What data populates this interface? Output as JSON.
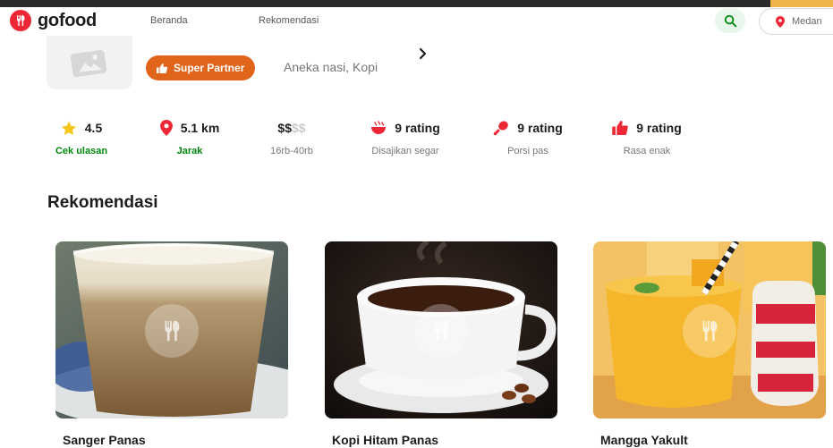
{
  "brand": {
    "name": "gofood",
    "color": "#ee2737"
  },
  "nav": {
    "links": [
      "Beranda",
      "Rekomendasi"
    ],
    "location": "Medan"
  },
  "restaurant": {
    "badge": "Super Partner",
    "badge_color": "#e0641a",
    "cuisine": "Aneka nasi, Kopi"
  },
  "stats": [
    {
      "icon": "star-icon",
      "value": "4.5",
      "label": "Cek ulasan"
    },
    {
      "icon": "location-pin-icon",
      "value": "5.1 km",
      "label": "Jarak"
    },
    {
      "icon": "",
      "value_active": "$$",
      "value_inactive": "$$",
      "label": "16rb-40rb"
    },
    {
      "icon": "bowl-icon",
      "value": "9 rating",
      "label": "Disajikan segar"
    },
    {
      "icon": "drumstick-icon",
      "value": "9 rating",
      "label": "Porsi pas"
    },
    {
      "icon": "thumbs-up-icon",
      "value": "9 rating",
      "label": "Rasa enak"
    }
  ],
  "section": {
    "title": "Rekomendasi"
  },
  "menu_items": [
    {
      "name": "Sanger Panas",
      "image": "latte-glass-photo"
    },
    {
      "name": "Kopi Hitam Panas",
      "image": "black-coffee-cup-photo"
    },
    {
      "name": "Mangga Yakult",
      "image": "mango-juice-photo"
    }
  ],
  "colors": {
    "accent_green": "#00880d",
    "text_dark": "#1c1c1c"
  }
}
